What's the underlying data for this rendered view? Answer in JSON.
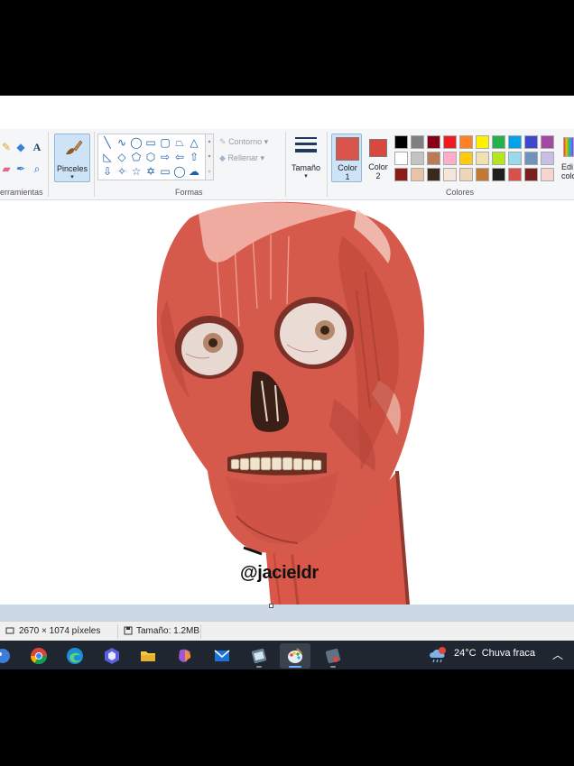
{
  "ribbon": {
    "tools_group_label": "erramientas",
    "brushes_label": "Pinceles",
    "shapes_group_label": "Formas",
    "outline_label": "Contorno",
    "fill_label": "Rellenar",
    "size_label": "Tamaño",
    "color1_label_line1": "Color",
    "color1_label_line2": "1",
    "color2_label_line1": "Color",
    "color2_label_line2": "2",
    "colors_group_label": "Colores",
    "edit_colors_line1": "Edi",
    "edit_colors_line2": "colo",
    "color1_value": "#d9544a",
    "color2_value": "#d9483e",
    "palette_row1": [
      "#000000",
      "#7f7f7f",
      "#880015",
      "#ed1c24",
      "#ff7f27",
      "#fff200",
      "#22b14c",
      "#00a2e8",
      "#3f48cc",
      "#a349a4"
    ],
    "palette_row2": [
      "#ffffff",
      "#c3c3c3",
      "#b97a57",
      "#ffaec9",
      "#ffc90e",
      "#efe4b0",
      "#b5e61d",
      "#99d9ea",
      "#7092be",
      "#c8bfe7"
    ],
    "palette_row3": [
      "#8b1a1a",
      "#e9c4a4",
      "#3a2a1c",
      "#f3e6d6",
      "#ecd7b8",
      "#c07a33",
      "#1f1f1f",
      "#d7504a",
      "#7b1f1f",
      "#f5d6cf"
    ]
  },
  "canvas": {
    "watermark": "@jacieldr"
  },
  "status": {
    "dimensions": "2670 × 1074 píxeles",
    "file_size": "Tamaño: 1.2MB"
  },
  "taskbar": {
    "apps": [
      "paint-partial",
      "chrome",
      "edge",
      "copilot-app",
      "file-explorer",
      "copilot",
      "mail",
      "photos",
      "paint",
      "snipping-tool"
    ],
    "weather_temp": "24°C",
    "weather_desc": "Chuva fraca"
  }
}
